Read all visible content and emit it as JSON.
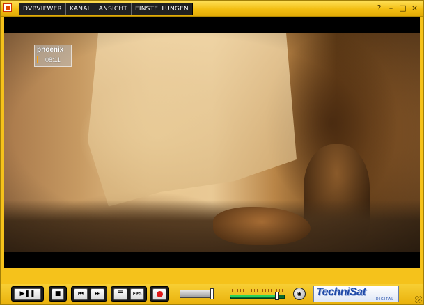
{
  "window": {
    "app_icon": "dvbviewer-app-icon",
    "accent_color": "#f5c21b"
  },
  "menu": {
    "items": [
      {
        "label": "DVBVIEWER"
      },
      {
        "label": "KANAL"
      },
      {
        "label": "ANSICHT"
      },
      {
        "label": "EINSTELLUNGEN"
      }
    ]
  },
  "window_controls": {
    "help": "?",
    "minimize": "–",
    "maximize": "□",
    "close": "×"
  },
  "video": {
    "channel_logo": {
      "name": "phoenix",
      "time": "08:11"
    }
  },
  "controls": {
    "play_pause_icon": "play-pause-icon",
    "play_pause_glyph": "▶❚❚",
    "stop_glyph": "■",
    "prev_glyph": "⏮",
    "next_glyph": "⏭",
    "playlist_glyph": "☰",
    "epg_label": "EPG",
    "record_icon": "record-icon",
    "audio_glyph": "◉",
    "volume_level": 0.88
  },
  "brand": {
    "name": "TechniSat",
    "sub": "DIGITAL"
  }
}
